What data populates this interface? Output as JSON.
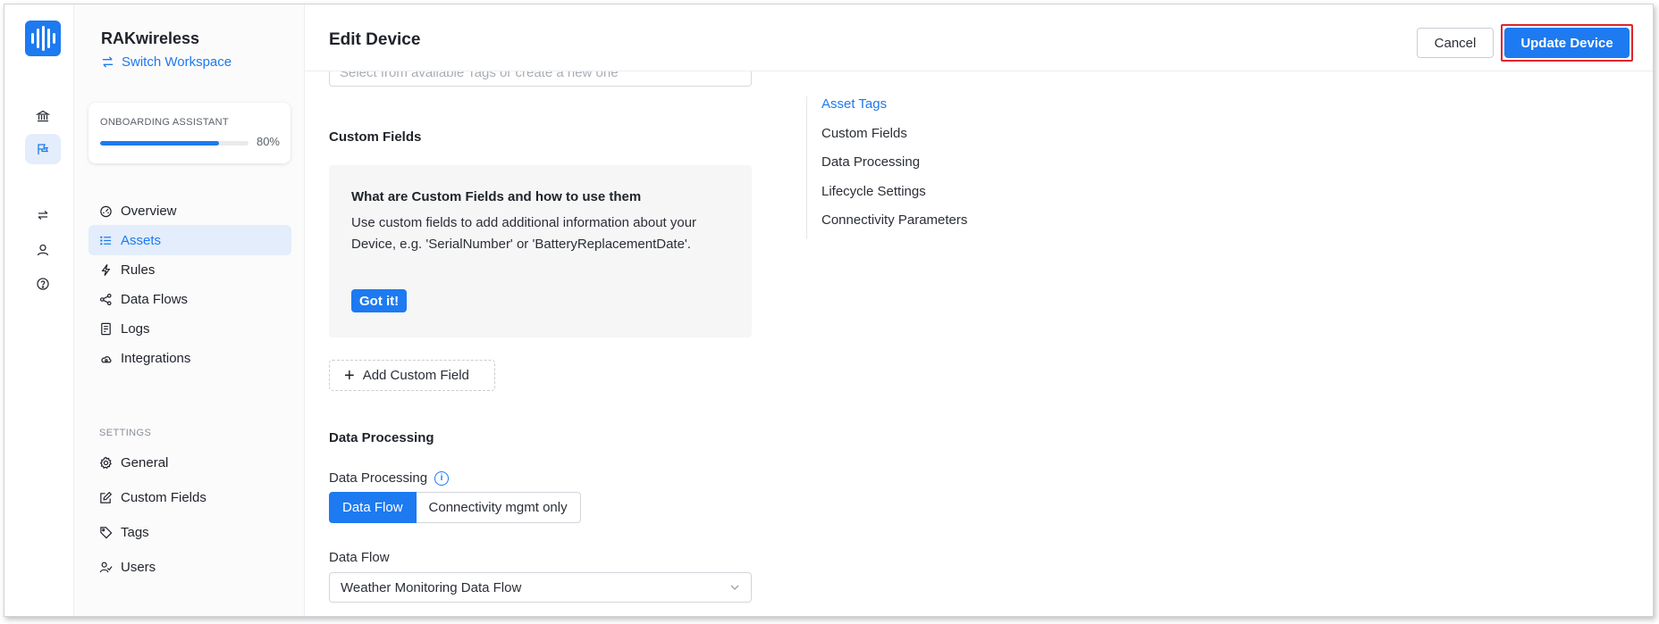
{
  "workspace": {
    "name": "RAKwireless",
    "switch_label": "Switch Workspace"
  },
  "onboarding": {
    "title": "ONBOARDING ASSISTANT",
    "percent_label": "80%",
    "progress": 0.8
  },
  "rail": {
    "items": [
      "bank-icon",
      "flag-icon",
      "swap-icon",
      "user-icon",
      "help-icon"
    ]
  },
  "sidebar": {
    "items": [
      {
        "label": "Overview",
        "icon": "dashboard-icon"
      },
      {
        "label": "Assets",
        "icon": "list-icon"
      },
      {
        "label": "Rules",
        "icon": "bolt-icon"
      },
      {
        "label": "Data Flows",
        "icon": "share-icon"
      },
      {
        "label": "Logs",
        "icon": "log-icon"
      },
      {
        "label": "Integrations",
        "icon": "cloud-icon"
      }
    ],
    "settings_label": "SETTINGS",
    "settings_items": [
      {
        "label": "General",
        "icon": "gear-icon"
      },
      {
        "label": "Custom Fields",
        "icon": "edit-icon"
      },
      {
        "label": "Tags",
        "icon": "tag-icon"
      },
      {
        "label": "Users",
        "icon": "users-icon"
      }
    ]
  },
  "header": {
    "title": "Edit Device",
    "cancel_label": "Cancel",
    "update_label": "Update Device"
  },
  "form": {
    "tags_placeholder": "Select from available Tags or create a new one",
    "custom_fields_heading": "Custom Fields",
    "info_title": "What are Custom Fields and how to use them",
    "info_text": "Use custom fields to add additional information about your Device, e.g. 'SerialNumber' or 'BatteryReplacementDate'.",
    "got_it_label": "Got it!",
    "add_field_label": "Add Custom Field",
    "data_processing_heading": "Data Processing",
    "data_processing_label": "Data Processing",
    "segment_options": [
      "Data Flow",
      "Connectivity mgmt only"
    ],
    "data_flow_label": "Data Flow",
    "data_flow_value": "Weather Monitoring Data Flow"
  },
  "toc": {
    "items": [
      "Asset Tags",
      "Custom Fields",
      "Data Processing",
      "Lifecycle Settings",
      "Connectivity Parameters"
    ],
    "active": "Asset Tags"
  },
  "colors": {
    "accent": "#1d7af0",
    "highlight_outline": "#e0242d"
  }
}
